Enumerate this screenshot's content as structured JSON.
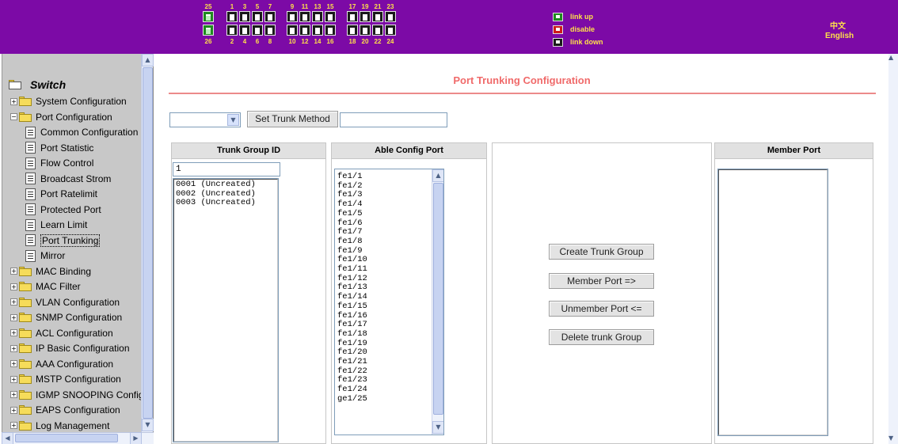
{
  "header": {
    "ports_top": [
      "25",
      "1",
      "3",
      "5",
      "7",
      "9",
      "11",
      "13",
      "15",
      "17",
      "19",
      "21",
      "23"
    ],
    "ports_bottom": [
      "26",
      "2",
      "4",
      "6",
      "8",
      "10",
      "12",
      "14",
      "16",
      "18",
      "20",
      "22",
      "24"
    ],
    "legend": [
      {
        "label": "link up",
        "color": "#1e8a1e"
      },
      {
        "label": "disable",
        "color": "#d01a1a"
      },
      {
        "label": "link down",
        "color": "#1a1a1a"
      }
    ],
    "lang_chinese": "中文",
    "lang_english": "English",
    "accent_color": "#7c0aa6"
  },
  "sidebar": {
    "root": "Switch",
    "items": [
      {
        "label": "System Configuration",
        "kind": "folder",
        "expander": "+"
      },
      {
        "label": "Port Configuration",
        "kind": "folder-open",
        "expander": "-"
      },
      {
        "label": "Common Configuration",
        "kind": "page"
      },
      {
        "label": "Port Statistic",
        "kind": "page"
      },
      {
        "label": "Flow Control",
        "kind": "page"
      },
      {
        "label": "Broadcast Strom",
        "kind": "page"
      },
      {
        "label": "Port Ratelimit",
        "kind": "page"
      },
      {
        "label": "Protected Port",
        "kind": "page"
      },
      {
        "label": "Learn Limit",
        "kind": "page"
      },
      {
        "label": "Port Trunking",
        "kind": "page",
        "selected": true
      },
      {
        "label": "Mirror",
        "kind": "page"
      },
      {
        "label": "MAC Binding",
        "kind": "folder",
        "expander": "+"
      },
      {
        "label": "MAC Filter",
        "kind": "folder",
        "expander": "+"
      },
      {
        "label": "VLAN Configuration",
        "kind": "folder",
        "expander": "+"
      },
      {
        "label": "SNMP Configuration",
        "kind": "folder",
        "expander": "+"
      },
      {
        "label": "ACL Configuration",
        "kind": "folder",
        "expander": "+"
      },
      {
        "label": "IP Basic Configuration",
        "kind": "folder",
        "expander": "+"
      },
      {
        "label": "AAA Configuration",
        "kind": "folder",
        "expander": "+"
      },
      {
        "label": "MSTP Configuration",
        "kind": "folder",
        "expander": "+"
      },
      {
        "label": "IGMP SNOOPING Config",
        "kind": "folder",
        "expander": "+"
      },
      {
        "label": "EAPS Configuration",
        "kind": "folder",
        "expander": "+"
      },
      {
        "label": "Log Management",
        "kind": "folder",
        "expander": "+"
      }
    ]
  },
  "main": {
    "title": "Port Trunking Configuration",
    "trunk_method_select": "",
    "set_trunk_method_button": "Set Trunk Method",
    "trunk_method_input": "",
    "headers": {
      "trunk_group_id": "Trunk Group ID",
      "able_config_port": "Able Config Port",
      "member_port": "Member Port"
    },
    "trunk_group_id_value": "1",
    "trunk_groups": [
      "0001 (Uncreated)",
      "0002 (Uncreated)",
      "0003 (Uncreated)"
    ],
    "able_ports": [
      "fe1/1",
      "fe1/2",
      "fe1/3",
      "fe1/4",
      "fe1/5",
      "fe1/6",
      "fe1/7",
      "fe1/8",
      "fe1/9",
      "fe1/10",
      "fe1/11",
      "fe1/12",
      "fe1/13",
      "fe1/14",
      "fe1/15",
      "fe1/16",
      "fe1/17",
      "fe1/18",
      "fe1/19",
      "fe1/20",
      "fe1/21",
      "fe1/22",
      "fe1/23",
      "fe1/24",
      "ge1/25"
    ],
    "member_ports": [],
    "buttons": {
      "create": "Create Trunk Group",
      "member": "Member Port =>",
      "unmember": "Unmember Port <=",
      "delete": "Delete trunk Group"
    }
  }
}
